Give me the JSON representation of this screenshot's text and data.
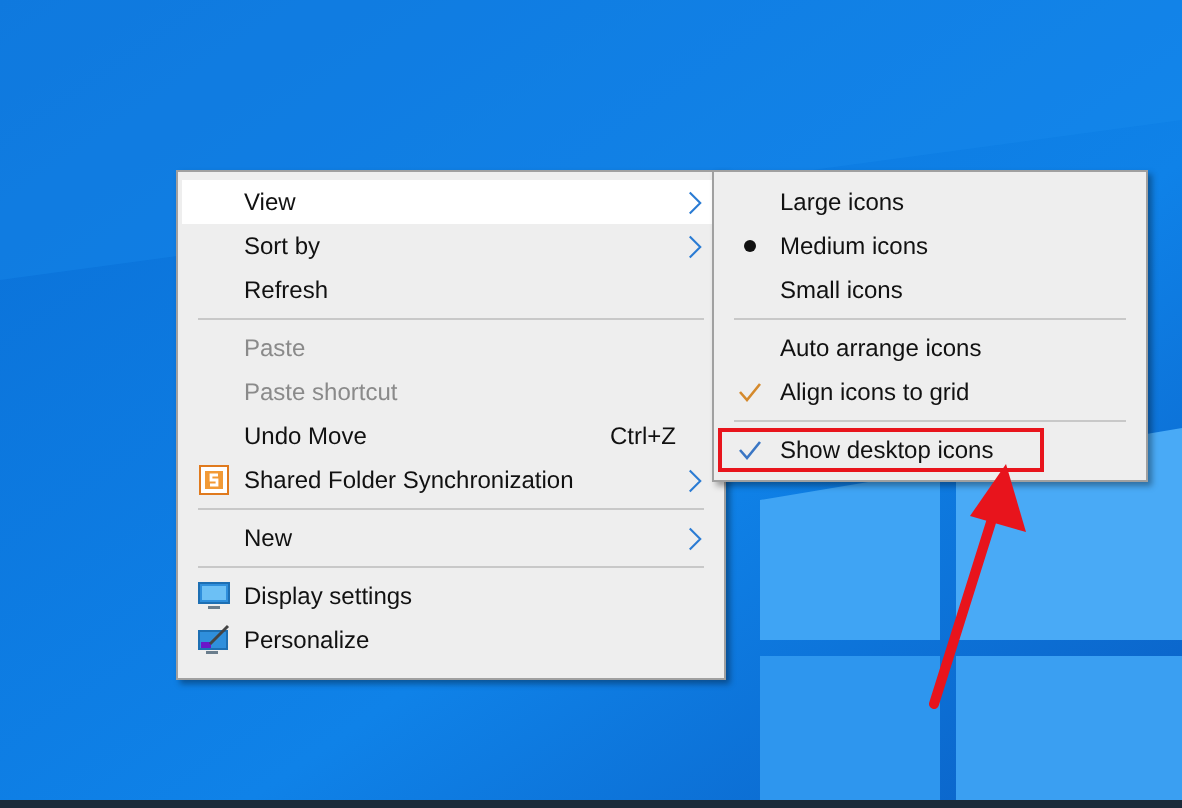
{
  "context_menu": {
    "items": [
      {
        "kind": "item",
        "label": "View",
        "selected": true,
        "disabled": false,
        "submenu": true
      },
      {
        "kind": "item",
        "label": "Sort by",
        "selected": false,
        "disabled": false,
        "submenu": true
      },
      {
        "kind": "item",
        "label": "Refresh",
        "selected": false,
        "disabled": false,
        "submenu": false
      },
      {
        "kind": "separator"
      },
      {
        "kind": "item",
        "label": "Paste",
        "selected": false,
        "disabled": true,
        "submenu": false
      },
      {
        "kind": "item",
        "label": "Paste shortcut",
        "selected": false,
        "disabled": true,
        "submenu": false
      },
      {
        "kind": "item",
        "label": "Undo Move",
        "shortcut": "Ctrl+Z",
        "selected": false,
        "disabled": false,
        "submenu": false
      },
      {
        "kind": "sync",
        "label": "Shared Folder Synchronization",
        "selected": false,
        "disabled": false,
        "submenu": true
      },
      {
        "kind": "separator"
      },
      {
        "kind": "item",
        "label": "New",
        "selected": false,
        "disabled": false,
        "submenu": true
      },
      {
        "kind": "separator"
      },
      {
        "kind": "display",
        "label": "Display settings",
        "selected": false,
        "disabled": false,
        "submenu": false
      },
      {
        "kind": "personalize",
        "label": "Personalize",
        "selected": false,
        "disabled": false,
        "submenu": false
      }
    ]
  },
  "view_submenu": {
    "items": [
      {
        "kind": "radio",
        "label": "Large icons",
        "checked": false
      },
      {
        "kind": "radio",
        "label": "Medium icons",
        "checked": true
      },
      {
        "kind": "radio",
        "label": "Small icons",
        "checked": false
      },
      {
        "kind": "separator"
      },
      {
        "kind": "check",
        "label": "Auto arrange icons",
        "checked": false
      },
      {
        "kind": "check",
        "label": "Align icons to grid",
        "checked": true
      },
      {
        "kind": "separator"
      },
      {
        "kind": "check",
        "label": "Show desktop icons",
        "checked": true,
        "highlighted": true
      }
    ]
  }
}
